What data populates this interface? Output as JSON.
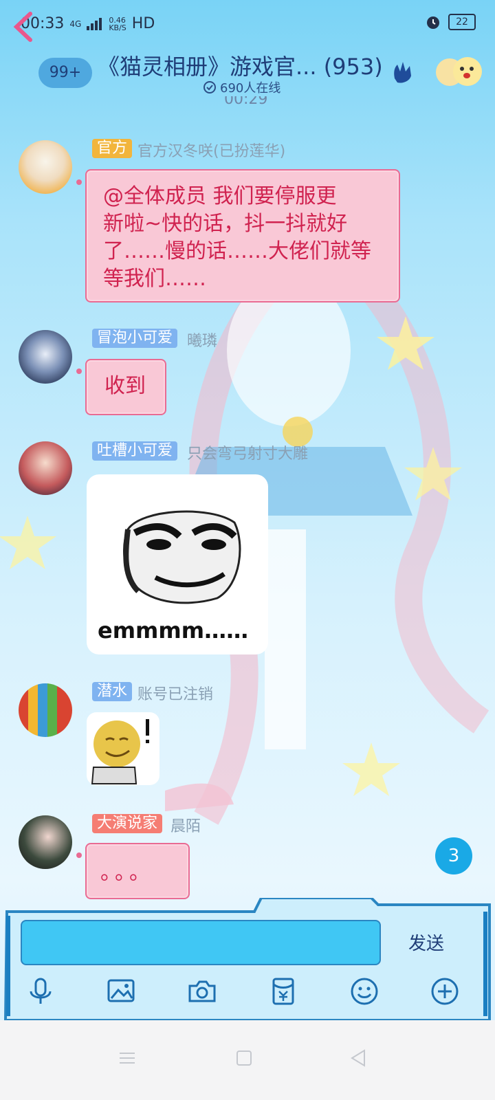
{
  "status_bar": {
    "time": "00:33",
    "network": "4G",
    "speed": "0.46\nKB/S",
    "hd": "HD",
    "battery": "22"
  },
  "header": {
    "unread_badge": "99+",
    "title": "《猫灵相册》游戏官... (953)",
    "online": "690人在线",
    "partial_timestamp": "00:29"
  },
  "messages": [
    {
      "tag": "官方",
      "tag_color": "#f2b53c",
      "name": "官方汉冬咲(已扮莲华)",
      "text_lines": [
        "@全体成员 我们要停服更",
        "新啦~快的话，抖一抖就好",
        "了……慢的话……大佬们就等",
        "等我们……"
      ]
    },
    {
      "tag": "冒泡小可爱",
      "tag_color": "#7fb3f0",
      "name": "曦璘",
      "text": "收到"
    },
    {
      "tag": "吐槽小可爱",
      "tag_color": "#7fb3f0",
      "name": "只会弯弓射寸大雕",
      "sticker_caption": "emmmm……"
    },
    {
      "tag": "潜水",
      "tag_color": "#7fb3f0",
      "name": "账号已注销"
    },
    {
      "tag": "大演说家",
      "tag_color": "#f57d73",
      "name": "晨陌",
      "text": "。。。"
    }
  ],
  "unread_count": "3",
  "composer": {
    "send_label": "发送",
    "input_value": ""
  },
  "colors": {
    "accent": "#1aa9e6",
    "bubble": "#f9c8d6",
    "bubble_text": "#d0224f"
  }
}
